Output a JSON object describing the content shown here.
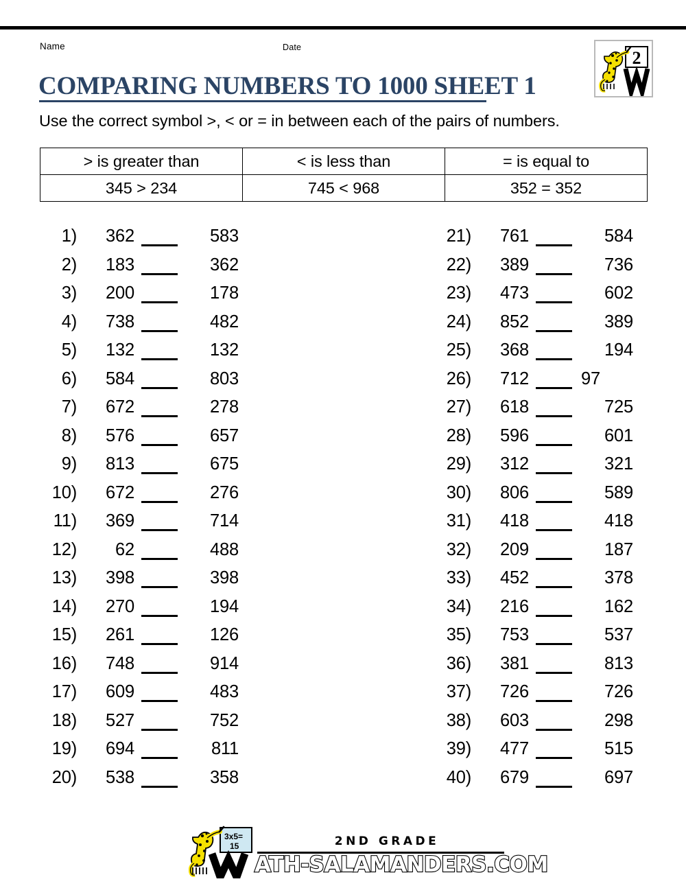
{
  "page": {
    "name_label": "Name",
    "date_label": "Date",
    "title": "COMPARING NUMBERS TO 1000 SHEET 1",
    "instruction": "Use the correct symbol >, < or = in between each of the pairs of numbers.",
    "title_color": "#2b4465",
    "badge": {
      "icon": "salamander-whiteboard-grade-badge",
      "board_text": "2"
    }
  },
  "legend": {
    "headers": [
      "> is greater than",
      "< is less than",
      "= is equal to"
    ],
    "examples": [
      "345 > 234",
      "745 < 968",
      "352 = 352"
    ]
  },
  "problems": {
    "left": [
      {
        "index": "1)",
        "a": "362",
        "b": "583"
      },
      {
        "index": "2)",
        "a": "183",
        "b": "362"
      },
      {
        "index": "3)",
        "a": "200",
        "b": "178"
      },
      {
        "index": "4)",
        "a": "738",
        "b": "482"
      },
      {
        "index": "5)",
        "a": "132",
        "b": "132"
      },
      {
        "index": "6)",
        "a": "584",
        "b": "803"
      },
      {
        "index": "7)",
        "a": "672",
        "b": "278"
      },
      {
        "index": "8)",
        "a": "576",
        "b": "657"
      },
      {
        "index": "9)",
        "a": "813",
        "b": "675"
      },
      {
        "index": "10)",
        "a": "672",
        "b": "276"
      },
      {
        "index": "11)",
        "a": "369",
        "b": "714"
      },
      {
        "index": "12)",
        "a": "62",
        "b": "488"
      },
      {
        "index": "13)",
        "a": "398",
        "b": "398"
      },
      {
        "index": "14)",
        "a": "270",
        "b": "194"
      },
      {
        "index": "15)",
        "a": "261",
        "b": "126"
      },
      {
        "index": "16)",
        "a": "748",
        "b": "914"
      },
      {
        "index": "17)",
        "a": "609",
        "b": "483"
      },
      {
        "index": "18)",
        "a": "527",
        "b": "752"
      },
      {
        "index": "19)",
        "a": "694",
        "b": "811"
      },
      {
        "index": "20)",
        "a": "538",
        "b": "358"
      }
    ],
    "right": [
      {
        "index": "21)",
        "a": "761",
        "b": "584"
      },
      {
        "index": "22)",
        "a": "389",
        "b": "736"
      },
      {
        "index": "23)",
        "a": "473",
        "b": "602"
      },
      {
        "index": "24)",
        "a": "852",
        "b": "389"
      },
      {
        "index": "25)",
        "a": "368",
        "b": "194"
      },
      {
        "index": "26)",
        "a": "712",
        "b": "97"
      },
      {
        "index": "27)",
        "a": "618",
        "b": "725"
      },
      {
        "index": "28)",
        "a": "596",
        "b": "601"
      },
      {
        "index": "29)",
        "a": "312",
        "b": "321"
      },
      {
        "index": "30)",
        "a": "806",
        "b": "589"
      },
      {
        "index": "31)",
        "a": "418",
        "b": "418"
      },
      {
        "index": "32)",
        "a": "209",
        "b": "187"
      },
      {
        "index": "33)",
        "a": "452",
        "b": "378"
      },
      {
        "index": "34)",
        "a": "216",
        "b": "162"
      },
      {
        "index": "35)",
        "a": "753",
        "b": "537"
      },
      {
        "index": "36)",
        "a": "381",
        "b": "813"
      },
      {
        "index": "37)",
        "a": "726",
        "b": "726"
      },
      {
        "index": "38)",
        "a": "603",
        "b": "298"
      },
      {
        "index": "39)",
        "a": "477",
        "b": "515"
      },
      {
        "index": "40)",
        "a": "679",
        "b": "697"
      }
    ]
  },
  "footer": {
    "grade": "2ND GRADE",
    "domain": "ATH-SALAMANDERS.COM",
    "mascot_icon": "salamander-whiteboard-logo",
    "board_text_line1": "3x5=",
    "board_text_line2": "15"
  }
}
